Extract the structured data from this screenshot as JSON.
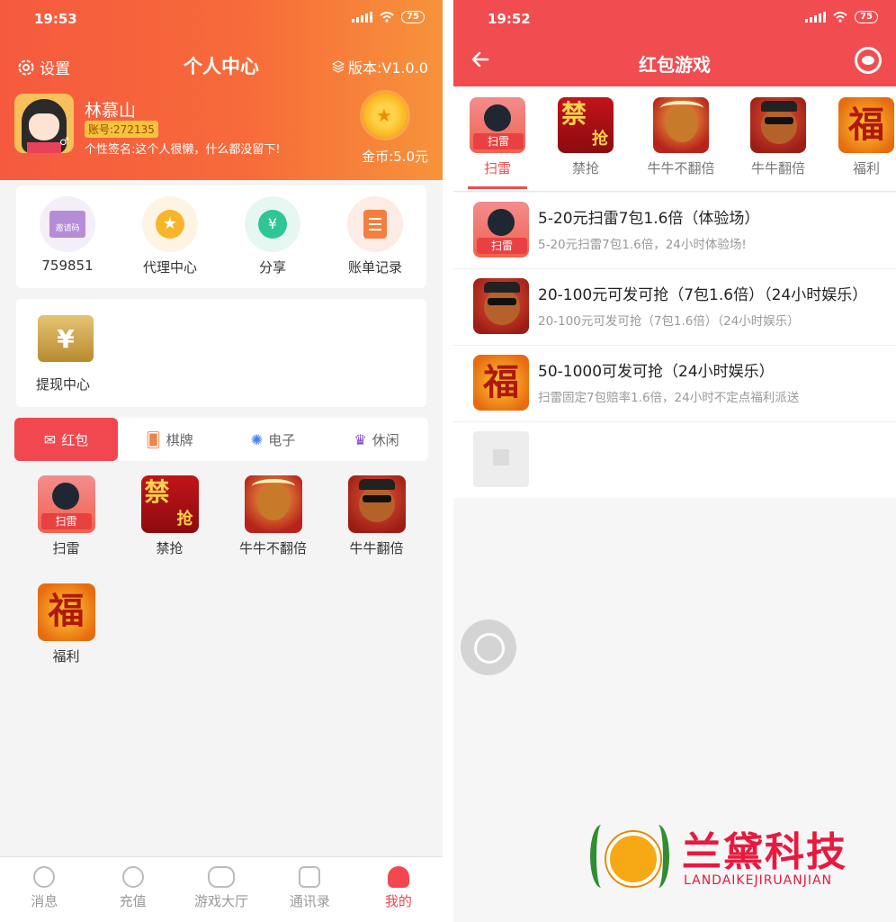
{
  "colors": {
    "header_gradient_start": "#f55a3f",
    "header_gradient_end": "#f7933a",
    "accent_red": "#f14c4f",
    "active_tab": "#f2474e"
  },
  "left": {
    "status": {
      "time": "19:53",
      "battery": "75"
    },
    "header": {
      "settings_label": "设置",
      "title": "个人中心",
      "version": "版本:V1.0.0"
    },
    "profile": {
      "name": "林慕山",
      "account": "账号:272135",
      "gender_icon": "♂",
      "bio": "个性签名:这个人很懒，什么都没留下!",
      "coins": "金币:5.0元"
    },
    "quick_items": [
      {
        "label": "759851",
        "icon": "invite-code-icon",
        "icon_text": "邀请码"
      },
      {
        "label": "代理中心",
        "icon": "agent-medal-icon"
      },
      {
        "label": "分享",
        "icon": "share-yuan-icon"
      },
      {
        "label": "账单记录",
        "icon": "bill-clipboard-icon"
      }
    ],
    "withdraw": {
      "label": "提现中心",
      "icon": "withdraw-yuan-icon"
    },
    "categories": [
      {
        "label": "红包",
        "active": true,
        "icon": "red-envelope-icon"
      },
      {
        "label": "棋牌",
        "active": false,
        "icon": "cards-icon"
      },
      {
        "label": "电子",
        "active": false,
        "icon": "wheel-icon"
      },
      {
        "label": "休闲",
        "active": false,
        "icon": "crown-icon"
      }
    ],
    "games": [
      {
        "label": "扫雷",
        "icon_text": "扫雷"
      },
      {
        "label": "禁抢",
        "icon_text_1": "禁",
        "icon_text_2": "抢"
      },
      {
        "label": "牛牛不翻倍"
      },
      {
        "label": "牛牛翻倍"
      },
      {
        "label": "福利",
        "icon_text": "福"
      }
    ],
    "tabbar": [
      {
        "label": "消息",
        "icon": "message-icon"
      },
      {
        "label": "充值",
        "icon": "recharge-icon"
      },
      {
        "label": "游戏大厅",
        "icon": "gamepad-icon"
      },
      {
        "label": "通讯录",
        "icon": "contacts-icon"
      },
      {
        "label": "我的",
        "icon": "user-icon",
        "active": true
      }
    ]
  },
  "right": {
    "status": {
      "time": "19:52",
      "battery": "75"
    },
    "header": {
      "back_icon": "arrow-left-icon",
      "title": "红包游戏",
      "service_icon": "customer-service-icon"
    },
    "tabs": [
      {
        "label": "扫雷",
        "active": true
      },
      {
        "label": "禁抢"
      },
      {
        "label": "牛牛不翻倍"
      },
      {
        "label": "牛牛翻倍"
      },
      {
        "label": "福利"
      }
    ],
    "rooms": [
      {
        "title": "5-20元扫雷7包1.6倍（体验场）",
        "desc": "5-20元扫雷7包1.6倍，24小时体验场!"
      },
      {
        "title": "20-100元可发可抢（7包1.6倍）（24小时娱乐）",
        "desc": "20-100元可发可抢（7包1.6倍）（24小时娱乐）"
      },
      {
        "title": "50-1000可发可抢（24小时娱乐）",
        "desc": "扫雷固定7包赔率1.6倍，24小时不定点福利派送"
      }
    ]
  },
  "watermark": {
    "name": "兰黛科技",
    "sub": "LANDAIKEJIRUANJIAN"
  }
}
